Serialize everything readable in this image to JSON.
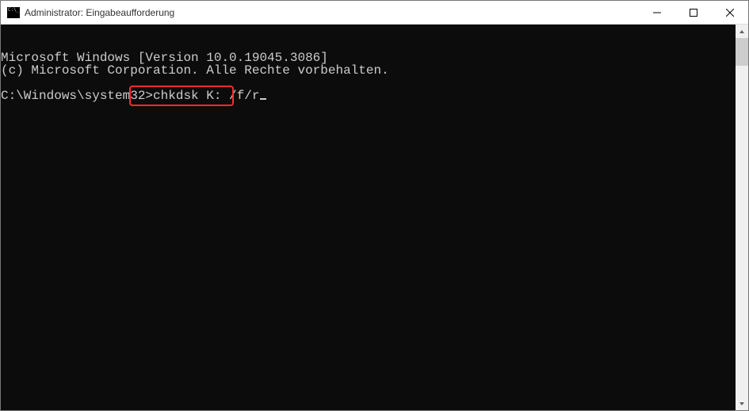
{
  "window": {
    "title": "Administrator: Eingabeaufforderung"
  },
  "terminal": {
    "line1": "Microsoft Windows [Version 10.0.19045.3086]",
    "line2": "(c) Microsoft Corporation. Alle Rechte vorbehalten.",
    "prompt": "C:\\Windows\\system32>",
    "command": "chkdsk K: /f/r"
  },
  "highlight": {
    "color": "#ff2a2a"
  }
}
